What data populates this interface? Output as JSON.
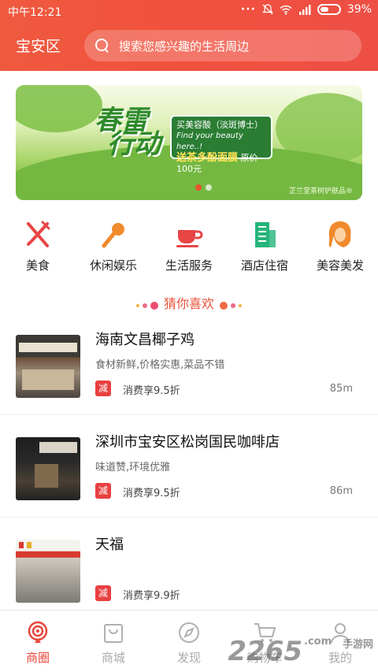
{
  "status_bar": {
    "time": "中午12:21",
    "battery": "39%"
  },
  "header": {
    "city": "宝安区",
    "search_placeholder": "搜索您感兴趣的生活周边"
  },
  "banner": {
    "title_line1": "春雷",
    "title_line2": "行动",
    "panel_line1": "买美容酸（淡斑博士）",
    "panel_en": "Find your beauty here..!",
    "panel_line2": "送茶多酚面膜",
    "panel_price": "原价100元",
    "credit": "芷兰堂茶树护肤品®"
  },
  "categories": [
    {
      "label": "美食",
      "icon": "fork-knife-icon",
      "color": "#e84545"
    },
    {
      "label": "休闲娱乐",
      "icon": "microphone-icon",
      "color": "#f08a2c"
    },
    {
      "label": "生活服务",
      "icon": "coffee-cup-icon",
      "color": "#e84545"
    },
    {
      "label": "酒店住宿",
      "icon": "hotel-building-icon",
      "color": "#26b47a"
    },
    {
      "label": "美容美发",
      "icon": "hair-salon-icon",
      "color": "#f08a2c"
    }
  ],
  "section_title": "猜你喜欢",
  "listings": [
    {
      "name": "海南文昌椰子鸡",
      "desc": "食材新鲜,价格实惠,菜品不错",
      "badge": "减",
      "offer": "消费享9.5折",
      "distance": "85m"
    },
    {
      "name": "深圳市宝安区松岗国民咖啡店",
      "desc": "味道赞,环境优雅",
      "badge": "减",
      "offer": "消费享9.5折",
      "distance": "86m"
    },
    {
      "name": "天福",
      "desc": "",
      "badge": "减",
      "offer": "消费享9.9折",
      "distance": ""
    }
  ],
  "bottom_nav": [
    {
      "label": "商圈",
      "icon": "location-signal-icon",
      "active": true
    },
    {
      "label": "商城",
      "icon": "shopping-bag-icon",
      "active": false
    },
    {
      "label": "发现",
      "icon": "compass-icon",
      "active": false
    },
    {
      "label": "购物车",
      "icon": "cart-icon",
      "active": false
    },
    {
      "label": "我的",
      "icon": "user-icon",
      "active": false
    }
  ],
  "watermark": {
    "number": "2265",
    "suffix": ".com",
    "sub": "手游网"
  },
  "colors": {
    "brand": "#ee503f",
    "badge": "#e84040",
    "active_nav": "#e9463c"
  }
}
